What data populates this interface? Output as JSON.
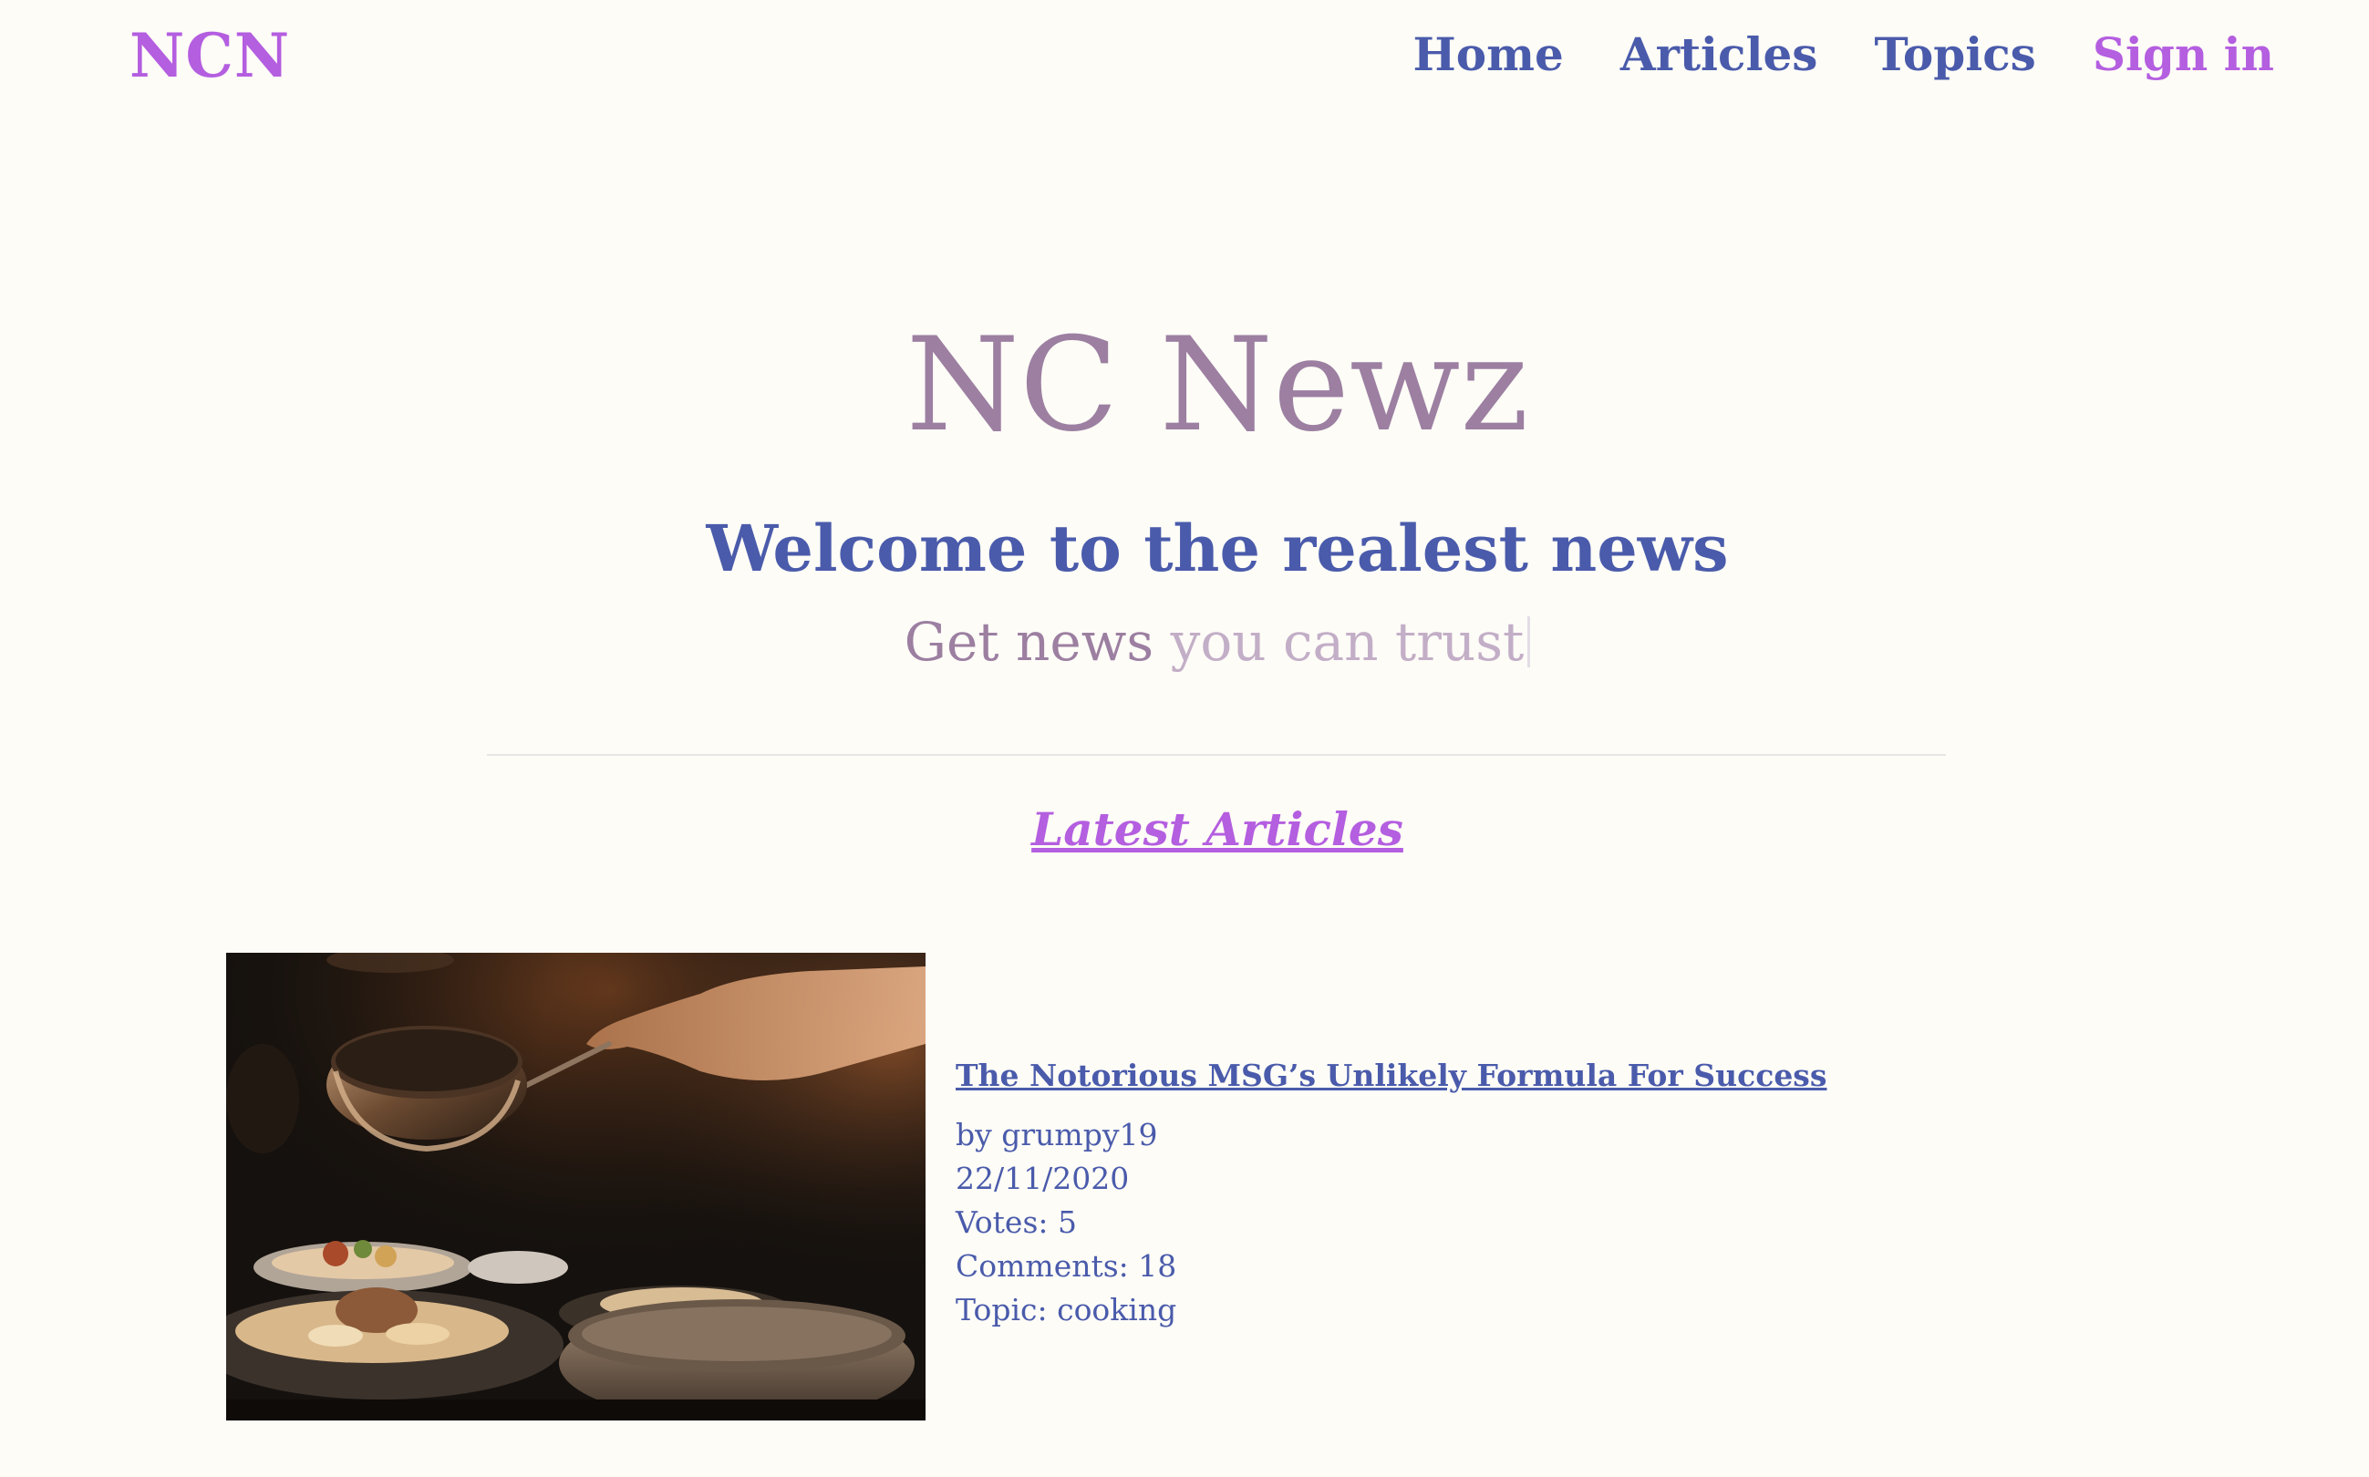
{
  "nav": {
    "brand": "NCN",
    "links": [
      "Home",
      "Articles",
      "Topics"
    ],
    "signin": "Sign in"
  },
  "hero": {
    "title": "NC Newz",
    "subtitle": "Welcome to the realest news",
    "tagline_start": "Get news ",
    "tagline_typed": "you can trust"
  },
  "section": {
    "heading": "Latest Articles"
  },
  "articles": [
    {
      "title": "The Notorious MSG’s Unlikely Formula For Success",
      "author_line": "by grumpy19",
      "date": "22/11/2020",
      "votes": "Votes: 5",
      "comments": "Comments: 18",
      "topic": "Topic: cooking"
    }
  ],
  "colors": {
    "background": "#fdfcf7",
    "brand": "#b45ee0",
    "primary": "#4a5bab",
    "muted": "#9c7fa1"
  }
}
